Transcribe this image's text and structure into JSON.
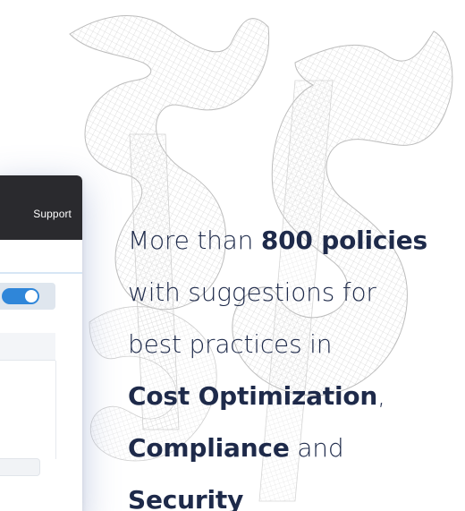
{
  "app_window": {
    "support_label": "Support",
    "toggle_state": "on",
    "accent_color": "#2f86d9",
    "header_color": "#2a2a2e"
  },
  "headline": {
    "line1_prefix": "More than ",
    "line1_bold": "800 policies",
    "line2": "with suggestions for",
    "line3": "best practices in",
    "line4_bold": "Cost Optimization",
    "line4_suffix": ",",
    "line5_bold": "Compliance",
    "line5_suffix": " and",
    "line6_bold": "Security",
    "text_color": "#1e2a4a"
  },
  "background_art": {
    "icon": "dollar-wireframe-icon"
  }
}
